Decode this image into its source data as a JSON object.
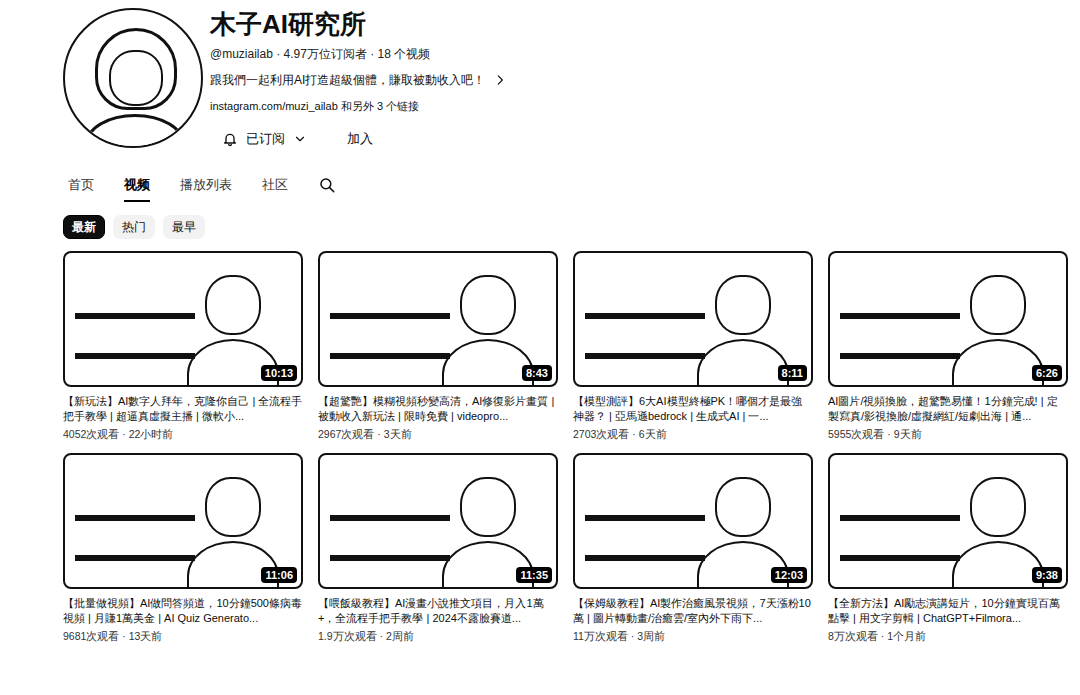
{
  "channel": {
    "name": "木子AI研究所",
    "stats": "@muziailab · 4.97万位订阅者 · 18 个视频",
    "description": "跟我們一起利用AI打造超級個體，賺取被動收入吧！",
    "link": "instagram.com/muzi_ailab 和另外 3 个链接",
    "subscribe": {
      "label": "已订阅"
    },
    "join": {
      "label": "加入"
    }
  },
  "tabs": [
    {
      "label": "首页",
      "selected": false
    },
    {
      "label": "视频",
      "selected": true
    },
    {
      "label": "播放列表",
      "selected": false
    },
    {
      "label": "社区",
      "selected": false
    }
  ],
  "chips": [
    {
      "label": "最新",
      "selected": true
    },
    {
      "label": "热门",
      "selected": false
    },
    {
      "label": "最早",
      "selected": false
    }
  ],
  "videos": [
    {
      "duration": "10:13",
      "title": "【新玩法】AI數字人拜年，克隆你自己 | 全流程手把手教學 | 超逼真虛擬主播 | 微軟小...",
      "meta": "4052次观看 · 22小时前"
    },
    {
      "duration": "8:43",
      "title": "【超驚艷】模糊視頻秒變高清，AI修復影片畫質 | 被動收入新玩法 | 限時免費 | videopro...",
      "meta": "2967次观看 · 3天前"
    },
    {
      "duration": "8:11",
      "title": "【模型測評】6大AI模型終極PK！哪個才是最強神器？ | 亞馬遜bedrock | 生成式AI | 一...",
      "meta": "2703次观看 · 6天前"
    },
    {
      "duration": "6:26",
      "title": "AI圖片/視頻換臉，超驚艷易懂！1分鐘完成! | 定製寫真/影視換臉/虛擬網紅/短劇出海 | 通...",
      "meta": "5955次观看 · 9天前"
    },
    {
      "duration": "11:06",
      "title": "【批量做視頻】AI做問答頻道，10分鐘500條病毒視頻 | 月賺1萬美金 | AI Quiz Generato...",
      "meta": "9681次观看 · 13天前"
    },
    {
      "duration": "11:35",
      "title": "【喂飯級教程】AI漫畫小說推文項目，月入1萬+，全流程手把手教學 | 2024不露臉賽道...",
      "meta": "1.9万次观看 · 2周前"
    },
    {
      "duration": "12:03",
      "title": "【保姆級教程】AI製作治癒風景視頻，7天漲粉10萬 | 圖片轉動畫/治癒雲/室內外下雨下...",
      "meta": "11万次观看 · 3周前"
    },
    {
      "duration": "9:38",
      "title": "【全新方法】AI勵志演講短片，10分鐘實現百萬點擊 | 用文字剪輯 | ChatGPT+Filmora...",
      "meta": "8万次观看 · 1个月前"
    }
  ]
}
